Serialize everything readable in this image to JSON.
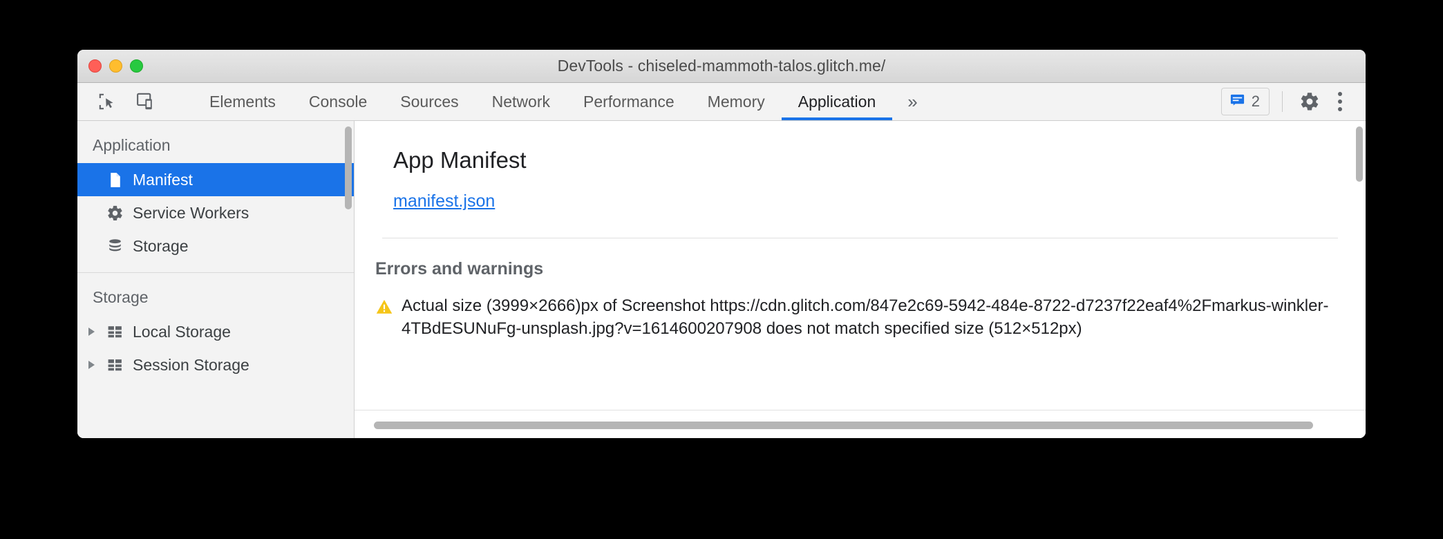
{
  "colors": {
    "accent": "#1a73e8",
    "warning": "#f5c518",
    "link": "#1a73e8",
    "selected_bg": "#1a73e8",
    "titlebar_bg": "#e2e2e2",
    "sidebar_bg": "#f3f3f3"
  },
  "window": {
    "title": "DevTools - chiseled-mammoth-talos.glitch.me/",
    "traffic_lights": [
      "close-button",
      "minimize-button",
      "maximize-button"
    ]
  },
  "toolbar": {
    "inspect_icon": "inspect-element-icon",
    "device_icon": "device-toolbar-icon",
    "tabs": [
      {
        "label": "Elements",
        "active": false
      },
      {
        "label": "Console",
        "active": false
      },
      {
        "label": "Sources",
        "active": false
      },
      {
        "label": "Network",
        "active": false
      },
      {
        "label": "Performance",
        "active": false
      },
      {
        "label": "Memory",
        "active": false
      },
      {
        "label": "Application",
        "active": true
      }
    ],
    "more_tabs_label": "»",
    "message_badge": {
      "icon": "message-icon",
      "count": "2"
    },
    "settings_icon": "gear-icon",
    "more_icon": "kebab-menu-icon"
  },
  "sidebar": {
    "groups": [
      {
        "title": "Application",
        "items": [
          {
            "label": "Manifest",
            "icon": "document-icon",
            "selected": true,
            "expandable": false
          },
          {
            "label": "Service Workers",
            "icon": "gear-icon",
            "selected": false,
            "expandable": false
          },
          {
            "label": "Storage",
            "icon": "database-icon",
            "selected": false,
            "expandable": false
          }
        ]
      },
      {
        "title": "Storage",
        "items": [
          {
            "label": "Local Storage",
            "icon": "table-icon",
            "selected": false,
            "expandable": true
          },
          {
            "label": "Session Storage",
            "icon": "table-icon",
            "selected": false,
            "expandable": true
          }
        ]
      }
    ]
  },
  "main": {
    "heading": "App Manifest",
    "manifest_link": "manifest.json",
    "errors_heading": "Errors and warnings",
    "warnings": [
      {
        "icon": "warning-triangle-icon",
        "text": "Actual size (3999×2666)px of Screenshot https://cdn.glitch.com/847e2c69-5942-484e-8722-d7237f22eaf4%2Fmarkus-winkler-4TBdESUNuFg-unsplash.jpg?v=1614600207908 does not match specified size (512×512px)"
      }
    ]
  }
}
